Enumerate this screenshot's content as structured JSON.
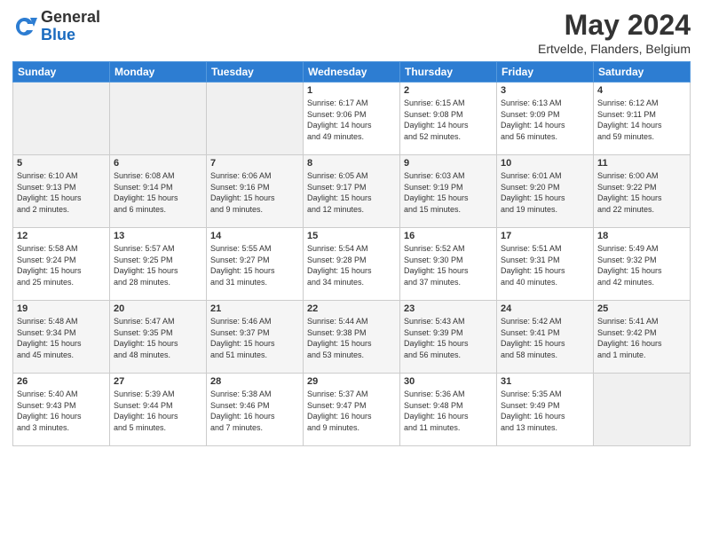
{
  "logo": {
    "general": "General",
    "blue": "Blue"
  },
  "header": {
    "month_year": "May 2024",
    "location": "Ertvelde, Flanders, Belgium"
  },
  "days_of_week": [
    "Sunday",
    "Monday",
    "Tuesday",
    "Wednesday",
    "Thursday",
    "Friday",
    "Saturday"
  ],
  "weeks": [
    [
      {
        "day": "",
        "info": ""
      },
      {
        "day": "",
        "info": ""
      },
      {
        "day": "",
        "info": ""
      },
      {
        "day": "1",
        "info": "Sunrise: 6:17 AM\nSunset: 9:06 PM\nDaylight: 14 hours\nand 49 minutes."
      },
      {
        "day": "2",
        "info": "Sunrise: 6:15 AM\nSunset: 9:08 PM\nDaylight: 14 hours\nand 52 minutes."
      },
      {
        "day": "3",
        "info": "Sunrise: 6:13 AM\nSunset: 9:09 PM\nDaylight: 14 hours\nand 56 minutes."
      },
      {
        "day": "4",
        "info": "Sunrise: 6:12 AM\nSunset: 9:11 PM\nDaylight: 14 hours\nand 59 minutes."
      }
    ],
    [
      {
        "day": "5",
        "info": "Sunrise: 6:10 AM\nSunset: 9:13 PM\nDaylight: 15 hours\nand 2 minutes."
      },
      {
        "day": "6",
        "info": "Sunrise: 6:08 AM\nSunset: 9:14 PM\nDaylight: 15 hours\nand 6 minutes."
      },
      {
        "day": "7",
        "info": "Sunrise: 6:06 AM\nSunset: 9:16 PM\nDaylight: 15 hours\nand 9 minutes."
      },
      {
        "day": "8",
        "info": "Sunrise: 6:05 AM\nSunset: 9:17 PM\nDaylight: 15 hours\nand 12 minutes."
      },
      {
        "day": "9",
        "info": "Sunrise: 6:03 AM\nSunset: 9:19 PM\nDaylight: 15 hours\nand 15 minutes."
      },
      {
        "day": "10",
        "info": "Sunrise: 6:01 AM\nSunset: 9:20 PM\nDaylight: 15 hours\nand 19 minutes."
      },
      {
        "day": "11",
        "info": "Sunrise: 6:00 AM\nSunset: 9:22 PM\nDaylight: 15 hours\nand 22 minutes."
      }
    ],
    [
      {
        "day": "12",
        "info": "Sunrise: 5:58 AM\nSunset: 9:24 PM\nDaylight: 15 hours\nand 25 minutes."
      },
      {
        "day": "13",
        "info": "Sunrise: 5:57 AM\nSunset: 9:25 PM\nDaylight: 15 hours\nand 28 minutes."
      },
      {
        "day": "14",
        "info": "Sunrise: 5:55 AM\nSunset: 9:27 PM\nDaylight: 15 hours\nand 31 minutes."
      },
      {
        "day": "15",
        "info": "Sunrise: 5:54 AM\nSunset: 9:28 PM\nDaylight: 15 hours\nand 34 minutes."
      },
      {
        "day": "16",
        "info": "Sunrise: 5:52 AM\nSunset: 9:30 PM\nDaylight: 15 hours\nand 37 minutes."
      },
      {
        "day": "17",
        "info": "Sunrise: 5:51 AM\nSunset: 9:31 PM\nDaylight: 15 hours\nand 40 minutes."
      },
      {
        "day": "18",
        "info": "Sunrise: 5:49 AM\nSunset: 9:32 PM\nDaylight: 15 hours\nand 42 minutes."
      }
    ],
    [
      {
        "day": "19",
        "info": "Sunrise: 5:48 AM\nSunset: 9:34 PM\nDaylight: 15 hours\nand 45 minutes."
      },
      {
        "day": "20",
        "info": "Sunrise: 5:47 AM\nSunset: 9:35 PM\nDaylight: 15 hours\nand 48 minutes."
      },
      {
        "day": "21",
        "info": "Sunrise: 5:46 AM\nSunset: 9:37 PM\nDaylight: 15 hours\nand 51 minutes."
      },
      {
        "day": "22",
        "info": "Sunrise: 5:44 AM\nSunset: 9:38 PM\nDaylight: 15 hours\nand 53 minutes."
      },
      {
        "day": "23",
        "info": "Sunrise: 5:43 AM\nSunset: 9:39 PM\nDaylight: 15 hours\nand 56 minutes."
      },
      {
        "day": "24",
        "info": "Sunrise: 5:42 AM\nSunset: 9:41 PM\nDaylight: 15 hours\nand 58 minutes."
      },
      {
        "day": "25",
        "info": "Sunrise: 5:41 AM\nSunset: 9:42 PM\nDaylight: 16 hours\nand 1 minute."
      }
    ],
    [
      {
        "day": "26",
        "info": "Sunrise: 5:40 AM\nSunset: 9:43 PM\nDaylight: 16 hours\nand 3 minutes."
      },
      {
        "day": "27",
        "info": "Sunrise: 5:39 AM\nSunset: 9:44 PM\nDaylight: 16 hours\nand 5 minutes."
      },
      {
        "day": "28",
        "info": "Sunrise: 5:38 AM\nSunset: 9:46 PM\nDaylight: 16 hours\nand 7 minutes."
      },
      {
        "day": "29",
        "info": "Sunrise: 5:37 AM\nSunset: 9:47 PM\nDaylight: 16 hours\nand 9 minutes."
      },
      {
        "day": "30",
        "info": "Sunrise: 5:36 AM\nSunset: 9:48 PM\nDaylight: 16 hours\nand 11 minutes."
      },
      {
        "day": "31",
        "info": "Sunrise: 5:35 AM\nSunset: 9:49 PM\nDaylight: 16 hours\nand 13 minutes."
      },
      {
        "day": "",
        "info": ""
      }
    ]
  ]
}
